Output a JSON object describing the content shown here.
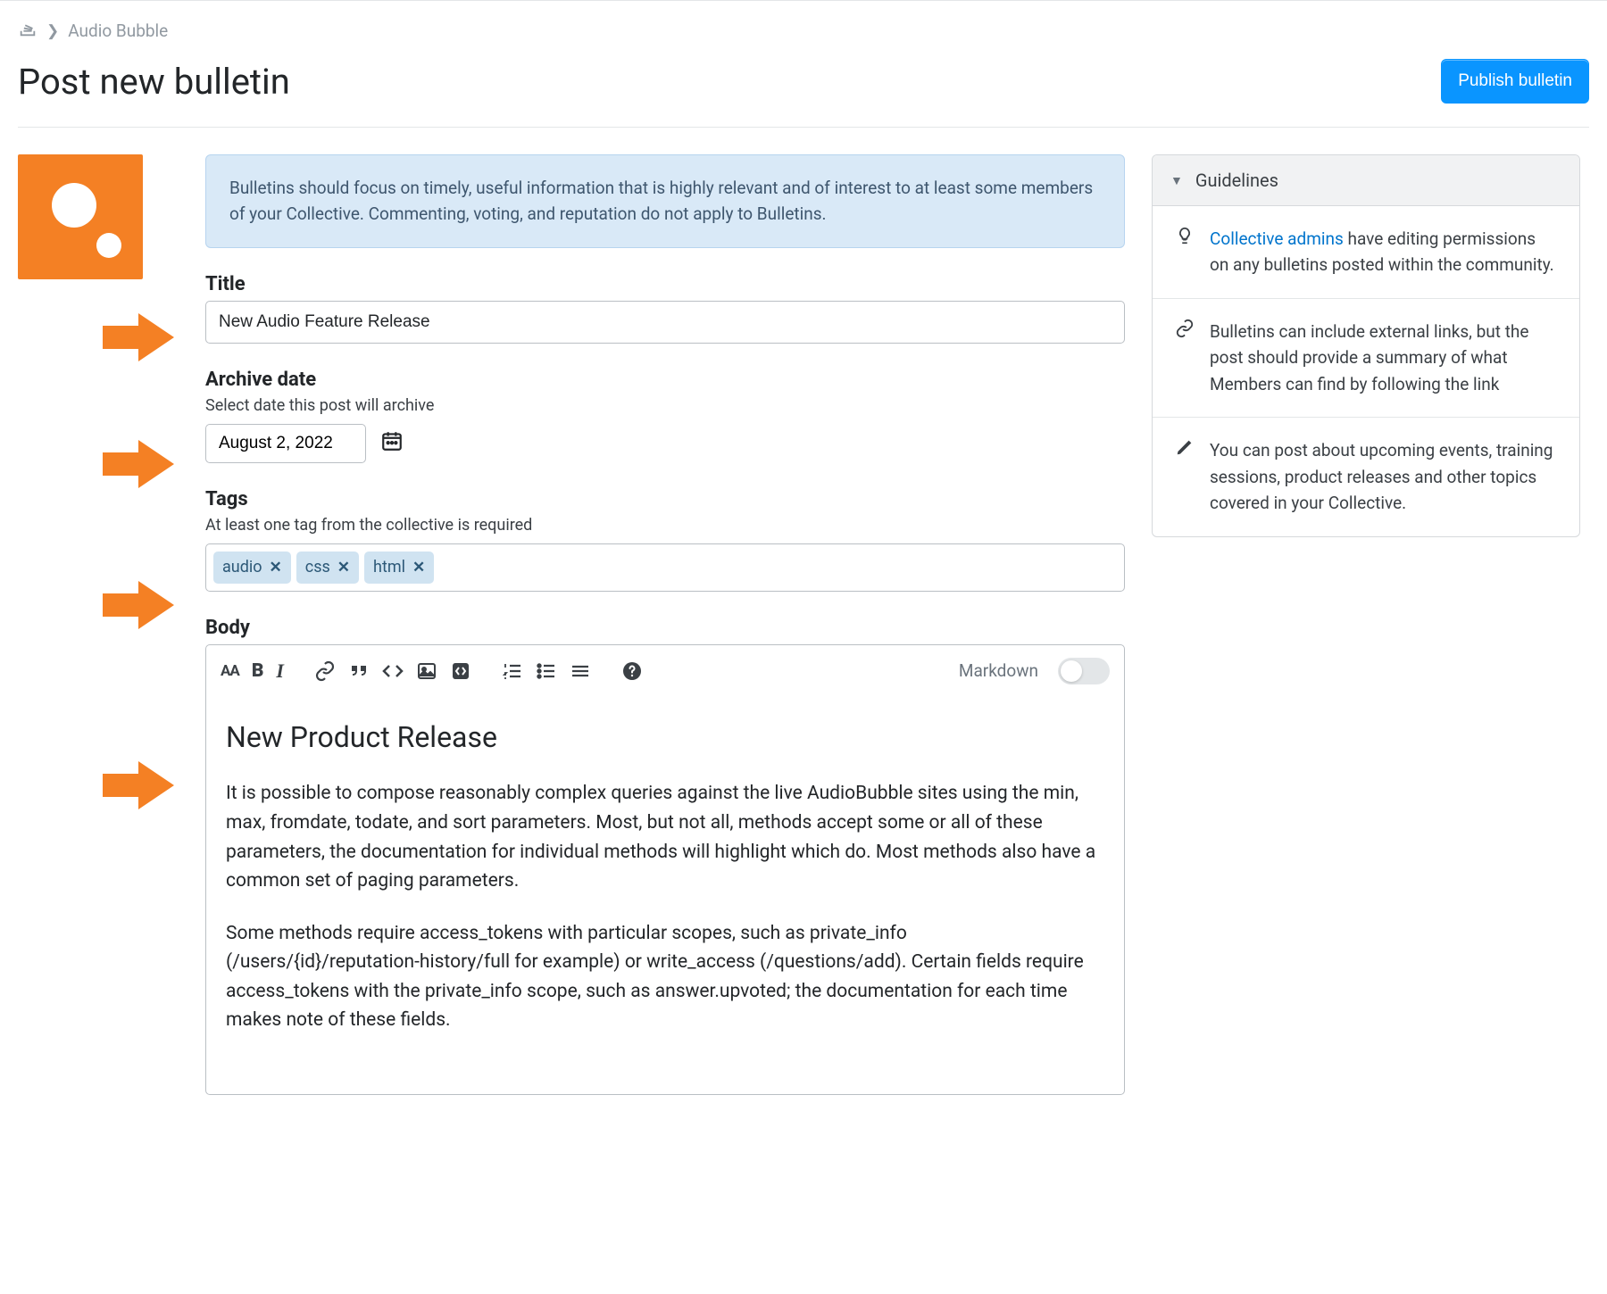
{
  "breadcrumb": {
    "link_text": "Audio Bubble"
  },
  "header": {
    "title": "Post new bulletin",
    "publish_button": "Publish bulletin"
  },
  "notice": "Bulletins should focus on timely, useful information that is highly relevant and of interest to at least some members of your Collective. Commenting, voting, and reputation do not apply to Bulletins.",
  "form": {
    "title_label": "Title",
    "title_value": "New Audio Feature Release",
    "archive_label": "Archive date",
    "archive_hint": "Select date this post will archive",
    "archive_value": "August 2, 2022",
    "tags_label": "Tags",
    "tags_hint": "At least one tag from the collective is required",
    "tags": [
      "audio",
      "css",
      "html"
    ],
    "body_label": "Body",
    "markdown_label": "Markdown"
  },
  "editor": {
    "heading": "New Product Release",
    "p1": "It is possible to compose reasonably complex queries against the live AudioBubble sites using the min, max, fromdate, todate, and sort parameters. Most, but not all, methods accept some or all of these parameters, the documentation for individual methods will highlight which do. Most methods also have a common set of paging parameters.",
    "p2": "Some methods require access_tokens with particular scopes, such as private_info (/users/{id}/reputation-history/full for example) or write_access (/questions/add). Certain fields require access_tokens with the private_info scope, such as answer.upvoted; the documentation for each time makes note of these fields."
  },
  "sidebar": {
    "header": "Guidelines",
    "items": [
      {
        "link": "Collective admins",
        "text_rest": " have editing permissions on any bulletins posted within the community."
      },
      {
        "text": "Bulletins can include external links, but the post should provide a summary of what Members can find by following the link"
      },
      {
        "text": "You can post about upcoming events, training sessions, product releases and other topics covered in your Collective."
      }
    ]
  }
}
